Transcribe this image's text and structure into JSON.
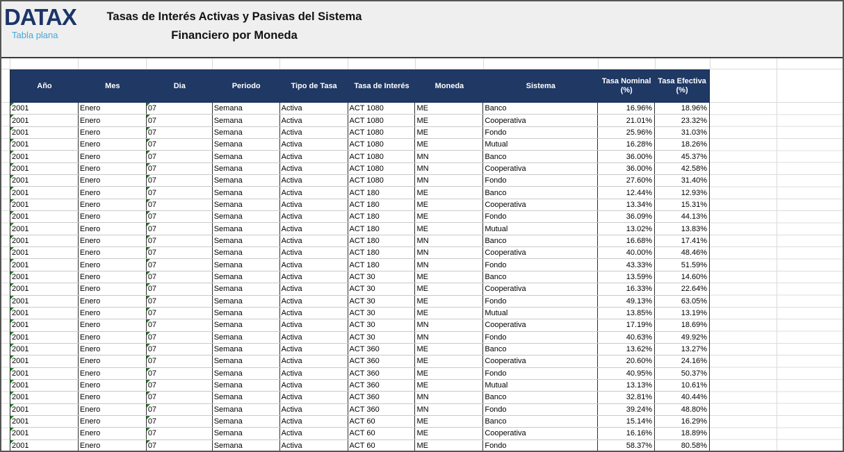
{
  "brand": {
    "name": "DATAX",
    "tagline": "Tabla plana"
  },
  "title": {
    "line1": "Tasas de Interés Activas y Pasivas del Sistema",
    "line2": "Financiero por Moneda"
  },
  "colors": {
    "header_bg": "#1F3864",
    "brand_navy": "#1C3568",
    "brand_blue": "#3FA9DC",
    "band_bg": "#EFEFEF",
    "flag_green": "#1A7F1A"
  },
  "table": {
    "columns": [
      {
        "key": "anio",
        "label": "Año"
      },
      {
        "key": "mes",
        "label": "Mes"
      },
      {
        "key": "dia",
        "label": "Dia"
      },
      {
        "key": "periodo",
        "label": "Periodo"
      },
      {
        "key": "tipo-de-tasa",
        "label": "Tipo de Tasa"
      },
      {
        "key": "tasa-de-interes",
        "label": "Tasa de Interés"
      },
      {
        "key": "moneda",
        "label": "Moneda"
      },
      {
        "key": "sistema",
        "label": "Sistema"
      },
      {
        "key": "tasa-nominal",
        "label": "Tasa Nominal (%)"
      },
      {
        "key": "tasa-efectiva",
        "label": "Tasa Efectiva (%)"
      }
    ],
    "numeric_columns": [
      8,
      9
    ],
    "flag_columns": [
      0,
      2
    ],
    "rows": [
      [
        "2001",
        "Enero",
        "07",
        "Semana",
        "Activa",
        "ACT 1080",
        "ME",
        "Banco",
        "16.96%",
        "18.96%"
      ],
      [
        "2001",
        "Enero",
        "07",
        "Semana",
        "Activa",
        "ACT 1080",
        "ME",
        "Cooperativa",
        "21.01%",
        "23.32%"
      ],
      [
        "2001",
        "Enero",
        "07",
        "Semana",
        "Activa",
        "ACT 1080",
        "ME",
        "Fondo",
        "25.96%",
        "31.03%"
      ],
      [
        "2001",
        "Enero",
        "07",
        "Semana",
        "Activa",
        "ACT 1080",
        "ME",
        "Mutual",
        "16.28%",
        "18.26%"
      ],
      [
        "2001",
        "Enero",
        "07",
        "Semana",
        "Activa",
        "ACT 1080",
        "MN",
        "Banco",
        "36.00%",
        "45.37%"
      ],
      [
        "2001",
        "Enero",
        "07",
        "Semana",
        "Activa",
        "ACT 1080",
        "MN",
        "Cooperativa",
        "36.00%",
        "42.58%"
      ],
      [
        "2001",
        "Enero",
        "07",
        "Semana",
        "Activa",
        "ACT 1080",
        "MN",
        "Fondo",
        "27.60%",
        "31.40%"
      ],
      [
        "2001",
        "Enero",
        "07",
        "Semana",
        "Activa",
        "ACT 180",
        "ME",
        "Banco",
        "12.44%",
        "12.93%"
      ],
      [
        "2001",
        "Enero",
        "07",
        "Semana",
        "Activa",
        "ACT 180",
        "ME",
        "Cooperativa",
        "13.34%",
        "15.31%"
      ],
      [
        "2001",
        "Enero",
        "07",
        "Semana",
        "Activa",
        "ACT 180",
        "ME",
        "Fondo",
        "36.09%",
        "44.13%"
      ],
      [
        "2001",
        "Enero",
        "07",
        "Semana",
        "Activa",
        "ACT 180",
        "ME",
        "Mutual",
        "13.02%",
        "13.83%"
      ],
      [
        "2001",
        "Enero",
        "07",
        "Semana",
        "Activa",
        "ACT 180",
        "MN",
        "Banco",
        "16.68%",
        "17.41%"
      ],
      [
        "2001",
        "Enero",
        "07",
        "Semana",
        "Activa",
        "ACT 180",
        "MN",
        "Cooperativa",
        "40.00%",
        "48.46%"
      ],
      [
        "2001",
        "Enero",
        "07",
        "Semana",
        "Activa",
        "ACT 180",
        "MN",
        "Fondo",
        "43.33%",
        "51.59%"
      ],
      [
        "2001",
        "Enero",
        "07",
        "Semana",
        "Activa",
        "ACT 30",
        "ME",
        "Banco",
        "13.59%",
        "14.60%"
      ],
      [
        "2001",
        "Enero",
        "07",
        "Semana",
        "Activa",
        "ACT 30",
        "ME",
        "Cooperativa",
        "16.33%",
        "22.64%"
      ],
      [
        "2001",
        "Enero",
        "07",
        "Semana",
        "Activa",
        "ACT 30",
        "ME",
        "Fondo",
        "49.13%",
        "63.05%"
      ],
      [
        "2001",
        "Enero",
        "07",
        "Semana",
        "Activa",
        "ACT 30",
        "ME",
        "Mutual",
        "13.85%",
        "13.19%"
      ],
      [
        "2001",
        "Enero",
        "07",
        "Semana",
        "Activa",
        "ACT 30",
        "MN",
        "Cooperativa",
        "17.19%",
        "18.69%"
      ],
      [
        "2001",
        "Enero",
        "07",
        "Semana",
        "Activa",
        "ACT 30",
        "MN",
        "Fondo",
        "40.63%",
        "49.92%"
      ],
      [
        "2001",
        "Enero",
        "07",
        "Semana",
        "Activa",
        "ACT 360",
        "ME",
        "Banco",
        "13.62%",
        "13.27%"
      ],
      [
        "2001",
        "Enero",
        "07",
        "Semana",
        "Activa",
        "ACT 360",
        "ME",
        "Cooperativa",
        "20.60%",
        "24.16%"
      ],
      [
        "2001",
        "Enero",
        "07",
        "Semana",
        "Activa",
        "ACT 360",
        "ME",
        "Fondo",
        "40.95%",
        "50.37%"
      ],
      [
        "2001",
        "Enero",
        "07",
        "Semana",
        "Activa",
        "ACT 360",
        "ME",
        "Mutual",
        "13.13%",
        "10.61%"
      ],
      [
        "2001",
        "Enero",
        "07",
        "Semana",
        "Activa",
        "ACT 360",
        "MN",
        "Banco",
        "32.81%",
        "40.44%"
      ],
      [
        "2001",
        "Enero",
        "07",
        "Semana",
        "Activa",
        "ACT 360",
        "MN",
        "Fondo",
        "39.24%",
        "48.80%"
      ],
      [
        "2001",
        "Enero",
        "07",
        "Semana",
        "Activa",
        "ACT 60",
        "ME",
        "Banco",
        "15.14%",
        "16.29%"
      ],
      [
        "2001",
        "Enero",
        "07",
        "Semana",
        "Activa",
        "ACT 60",
        "ME",
        "Cooperativa",
        "16.16%",
        "18.89%"
      ],
      [
        "2001",
        "Enero",
        "07",
        "Semana",
        "Activa",
        "ACT 60",
        "ME",
        "Fondo",
        "58.37%",
        "80.58%"
      ]
    ]
  }
}
